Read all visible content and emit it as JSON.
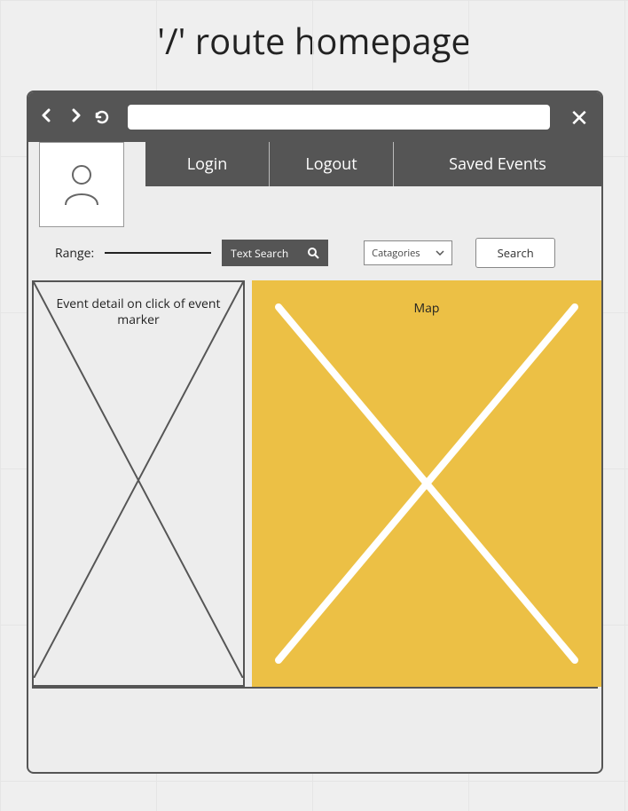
{
  "page_title": "'/' route homepage",
  "browser": {
    "url": ""
  },
  "nav": {
    "login": "Login",
    "logout": "Logout",
    "saved_events": "Saved Events"
  },
  "controls": {
    "range_label": "Range:",
    "text_search_label": "Text Search",
    "categories_label": "Catagories",
    "search_button": "Search"
  },
  "panels": {
    "detail_label": "Event detail on click of event marker",
    "map_label": "Map"
  }
}
